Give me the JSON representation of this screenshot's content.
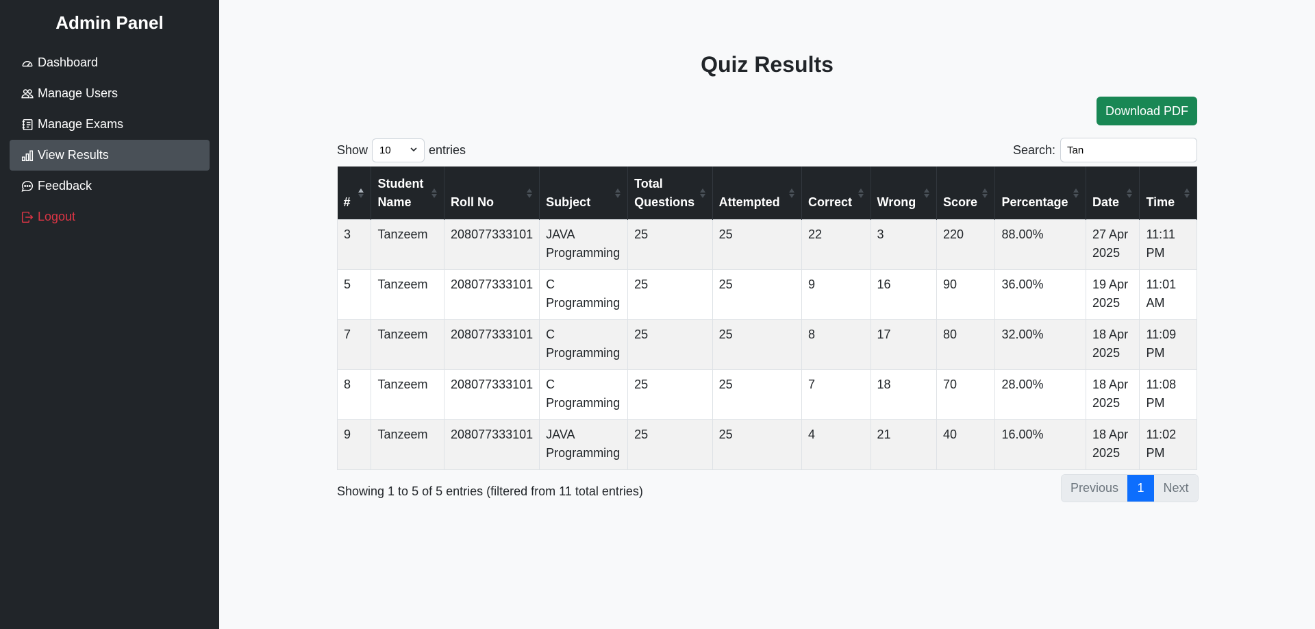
{
  "sidebar": {
    "brand": "Admin Panel",
    "items": [
      {
        "label": "Dashboard",
        "icon": "speedometer-icon"
      },
      {
        "label": "Manage Users",
        "icon": "people-icon"
      },
      {
        "label": "Manage Exams",
        "icon": "journal-icon"
      },
      {
        "label": "View Results",
        "icon": "bar-chart-icon",
        "active": true
      },
      {
        "label": "Feedback",
        "icon": "chat-dots-icon"
      },
      {
        "label": "Logout",
        "icon": "box-arrow-right-icon"
      }
    ]
  },
  "page": {
    "title": "Quiz Results",
    "download_label": "Download PDF"
  },
  "controls": {
    "show_label": "Show",
    "entries_label": "entries",
    "page_length": "10",
    "search_label": "Search:",
    "search_value": "Tan"
  },
  "table": {
    "headers": [
      "#",
      "Student Name",
      "Roll No",
      "Subject",
      "Total Questions",
      "Attempted",
      "Correct",
      "Wrong",
      "Score",
      "Percentage",
      "Date",
      "Time"
    ],
    "rows": [
      [
        "3",
        "Tanzeem",
        "208077333101",
        "JAVA Programming",
        "25",
        "25",
        "22",
        "3",
        "220",
        "88.00%",
        "27 Apr 2025",
        "11:11 PM"
      ],
      [
        "5",
        "Tanzeem",
        "208077333101",
        "C Programming",
        "25",
        "25",
        "9",
        "16",
        "90",
        "36.00%",
        "19 Apr 2025",
        "11:01 AM"
      ],
      [
        "7",
        "Tanzeem",
        "208077333101",
        "C Programming",
        "25",
        "25",
        "8",
        "17",
        "80",
        "32.00%",
        "18 Apr 2025",
        "11:09 PM"
      ],
      [
        "8",
        "Tanzeem",
        "208077333101",
        "C Programming",
        "25",
        "25",
        "7",
        "18",
        "70",
        "28.00%",
        "18 Apr 2025",
        "11:08 PM"
      ],
      [
        "9",
        "Tanzeem",
        "208077333101",
        "JAVA Programming",
        "25",
        "25",
        "4",
        "21",
        "40",
        "16.00%",
        "18 Apr 2025",
        "11:02 PM"
      ]
    ]
  },
  "footer": {
    "info": "Showing 1 to 5 of 5 entries (filtered from 11 total entries)",
    "previous": "Previous",
    "current_page": "1",
    "next": "Next"
  },
  "colors": {
    "sidebar_bg": "#212529",
    "active_item_bg": "#495057",
    "logout": "#dc3545",
    "download_button": "#198754",
    "page_active": "#0d6efd"
  }
}
